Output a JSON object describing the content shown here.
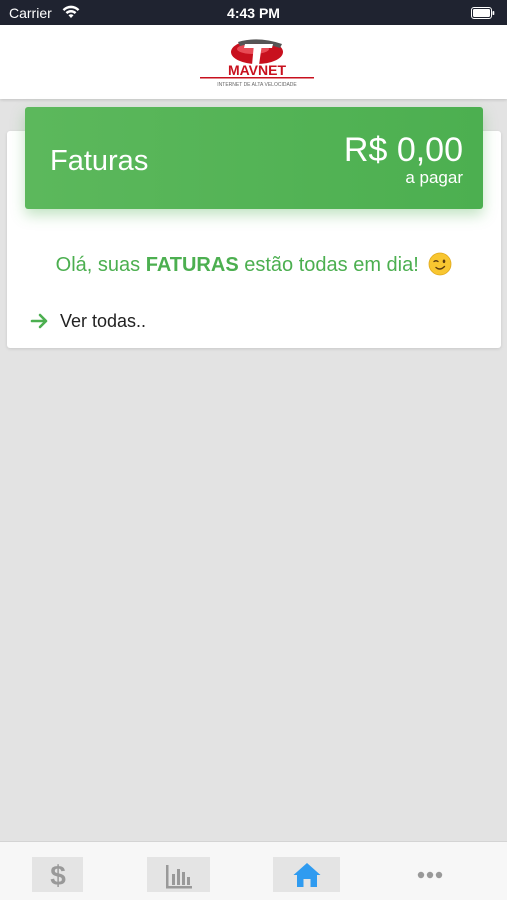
{
  "status_bar": {
    "carrier": "Carrier",
    "time": "4:43 PM",
    "wifi_icon": "wifi-icon",
    "battery_icon": "battery-icon"
  },
  "header": {
    "logo_text": "MAVNET",
    "logo_tagline": "INTERNET DE ALTA VELOCIDADE"
  },
  "faturas_card": {
    "title": "Faturas",
    "amount": "R$ 0,00",
    "amount_caption": "a pagar",
    "message_pre": "Olá, suas ",
    "message_bold": "FATURAS",
    "message_post": " estão todas em dia!",
    "message_emoji_icon": "wink-emoji-icon",
    "link_icon": "arrow-right-icon",
    "link_label": "Ver todas.."
  },
  "tabbar": {
    "tabs": [
      {
        "icon": "dollar-icon",
        "active": false
      },
      {
        "icon": "bar-chart-icon",
        "active": false
      },
      {
        "icon": "home-icon",
        "active": true
      },
      {
        "icon": "more-dots-icon",
        "active": false
      }
    ]
  },
  "colors": {
    "status_bar_bg": "#1f2330",
    "accent_green": "#4caf50",
    "active_tab_blue": "#2f9bf0",
    "inactive_tab_gray": "#999999",
    "page_bg": "#e3e3e3"
  }
}
